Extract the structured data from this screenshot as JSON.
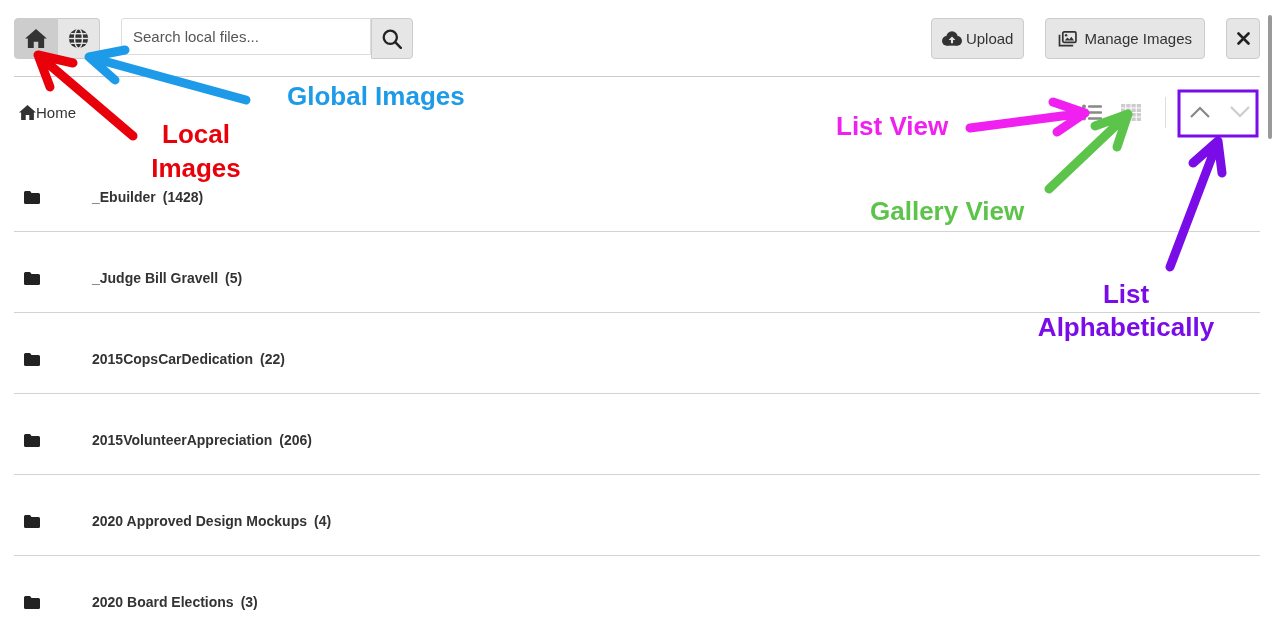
{
  "toolbar": {
    "sources": [
      {
        "selected": true
      },
      {
        "selected": false
      }
    ],
    "search": {
      "placeholder": "Search local files..."
    },
    "upload_button": {
      "label": "Upload"
    },
    "manage_button": {
      "label": "Manage Images"
    }
  },
  "breadcrumb": [
    {
      "label": "Home"
    }
  ],
  "view_modes": [
    {
      "selected": true
    },
    {
      "selected": false
    }
  ],
  "sort_order": [
    {
      "selected": true
    },
    {
      "selected": false
    }
  ],
  "folders": [
    {
      "name": "_Ebuilder",
      "count": "(1428)"
    },
    {
      "name": "_Judge Bill Gravell",
      "count": "(5)"
    },
    {
      "name": "2015CopsCarDedication",
      "count": "(22)"
    },
    {
      "name": "2015VolunteerAppreciation",
      "count": "(206)"
    },
    {
      "name": "2020 Approved Design Mockups",
      "count": "(4)"
    },
    {
      "name": "2020 Board Elections",
      "count": "(3)"
    }
  ],
  "callouts": [
    {
      "label": "Local Images",
      "color": "#e8000b",
      "boxed": false
    },
    {
      "label": "Global Images",
      "color": "#1d9be9",
      "boxed": false
    },
    {
      "label": "List View",
      "color": "#f020f0",
      "boxed": false
    },
    {
      "label": "Gallery View",
      "color": "#5cc44a",
      "boxed": false
    },
    {
      "label": "List Alphabetically",
      "color": "#7a0ce8",
      "boxed": true
    }
  ]
}
